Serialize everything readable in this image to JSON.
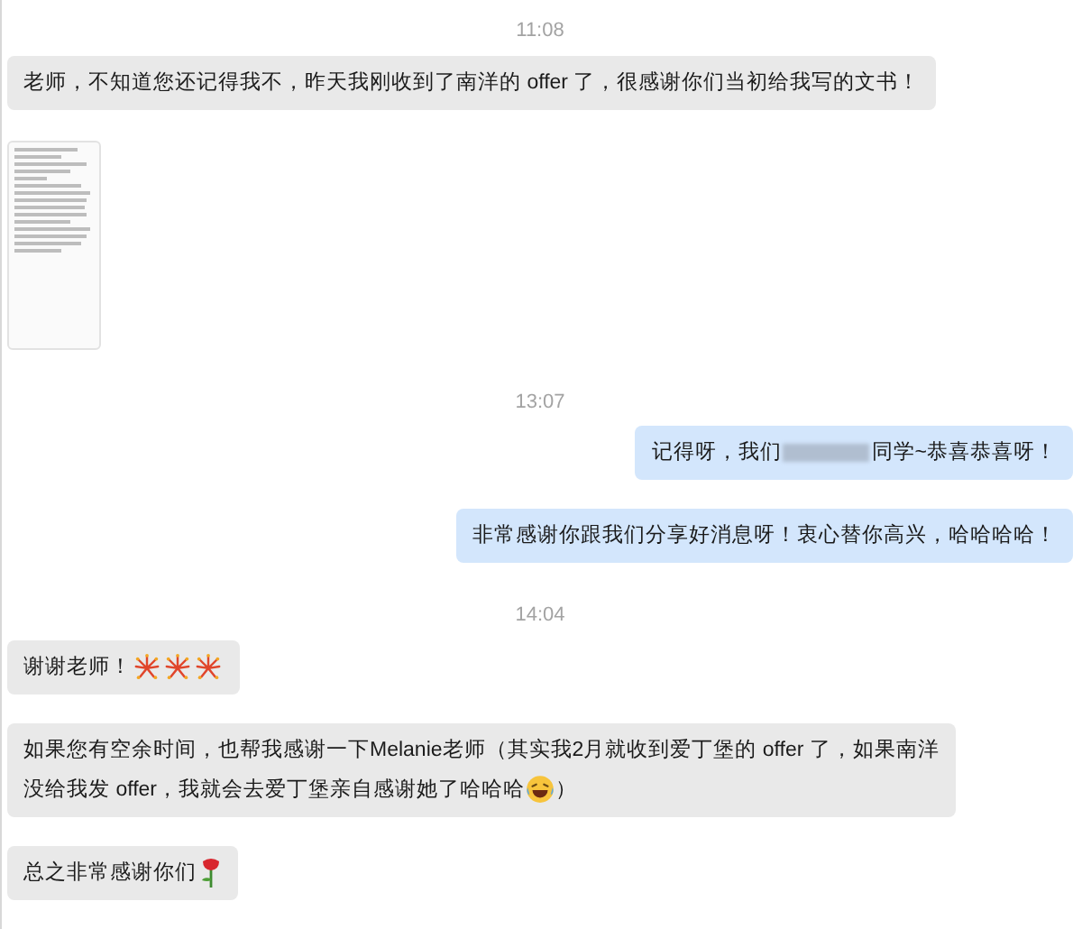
{
  "messages": [
    {
      "kind": "time",
      "text": "11:08"
    },
    {
      "kind": "text",
      "outgoing": false,
      "lines": [
        [
          {
            "kind": "text",
            "text": "老师，不知道您还记得我不，昨天我刚收到了南洋的 offer 了，很感谢你们当初给我写的文书！"
          }
        ]
      ]
    },
    {
      "kind": "image"
    },
    {
      "kind": "time",
      "text": "13:07"
    },
    {
      "kind": "text",
      "outgoing": true,
      "lines": [
        [
          {
            "kind": "text",
            "text": "记得呀，我们"
          },
          {
            "kind": "redaction"
          },
          {
            "kind": "text",
            "text": "同学~恭喜恭喜呀！"
          }
        ]
      ]
    },
    {
      "kind": "text",
      "outgoing": true,
      "lines": [
        [
          {
            "kind": "text",
            "text": "非常感谢你跟我们分享好消息呀！衷心替你高兴，哈哈哈哈！"
          }
        ]
      ]
    },
    {
      "kind": "time",
      "text": "14:04"
    },
    {
      "kind": "text",
      "outgoing": false,
      "lines": [
        [
          {
            "kind": "text",
            "text": "谢谢老师！"
          },
          {
            "kind": "fireworks"
          },
          {
            "kind": "fireworks"
          },
          {
            "kind": "fireworks"
          }
        ]
      ]
    },
    {
      "kind": "text",
      "outgoing": false,
      "lines": [
        [
          {
            "kind": "text",
            "text": "如果您有空余时间，也帮我感谢一下Melanie老师（其实我2月就收到爱丁堡的 offer 了，如果南洋"
          }
        ],
        [
          {
            "kind": "text",
            "text": "没给我发 offer，我就会去爱丁堡亲自感谢她了哈哈哈"
          },
          {
            "kind": "laugh"
          },
          {
            "kind": "text",
            "text": "）"
          }
        ]
      ]
    },
    {
      "kind": "text",
      "outgoing": false,
      "lines": [
        [
          {
            "kind": "text",
            "text": "总之非常感谢你们"
          },
          {
            "kind": "rose"
          }
        ]
      ]
    }
  ]
}
